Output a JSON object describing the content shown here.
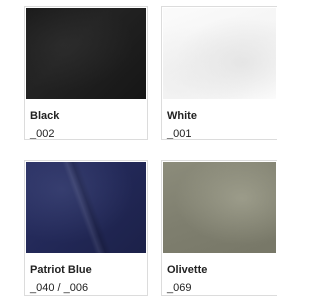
{
  "swatches": [
    {
      "name": "Black",
      "code": "_002",
      "color": "#1d1d1d"
    },
    {
      "name": "White",
      "code": "_001",
      "color": "#f7f7f7"
    },
    {
      "name": "Patriot Blue",
      "code": "_040 / _006",
      "color": "#242a5a"
    },
    {
      "name": "Olivette",
      "code": "_069",
      "color": "#838373"
    }
  ],
  "colors": {
    "card_border": "#dcdcdc",
    "text": "#222222"
  }
}
